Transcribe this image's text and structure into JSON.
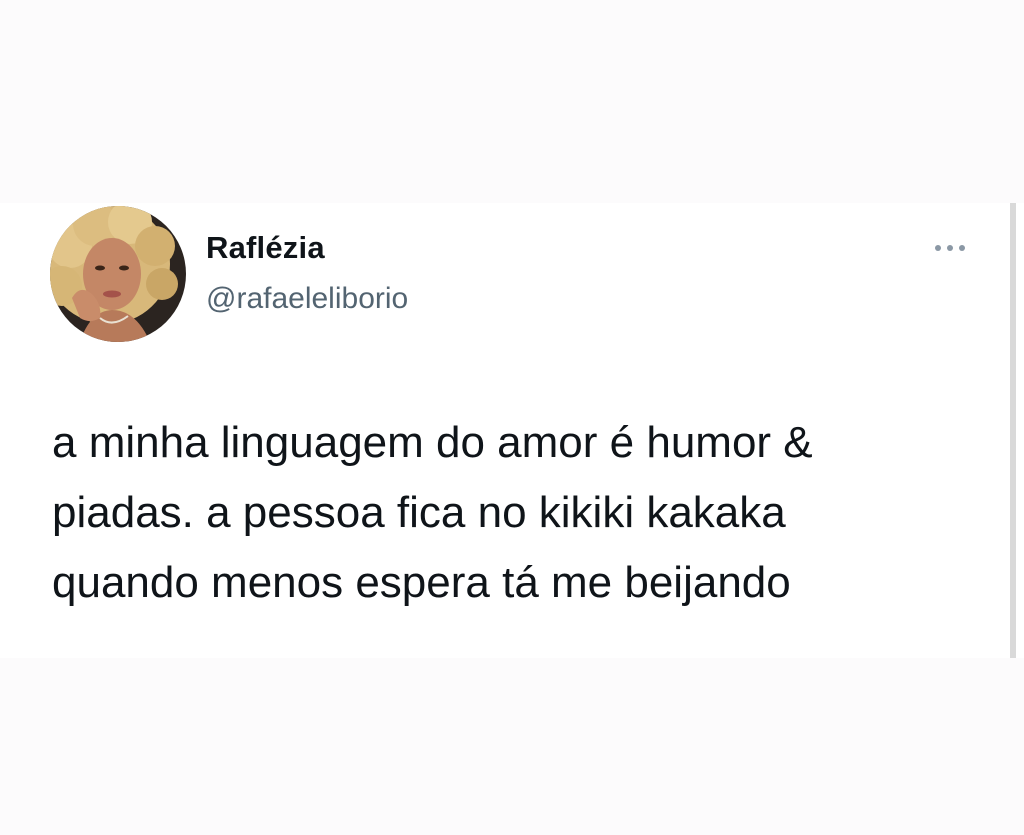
{
  "tweet": {
    "author": {
      "display_name": "Raflézia",
      "handle": "@rafaeleliborio",
      "avatar_icon": "profile-photo"
    },
    "more_icon": "more-horizontal-icon",
    "text_lines": [
      "a minha linguagem do amor é humor &",
      "piadas. a pessoa fica no kikiki kakaka",
      "quando menos espera tá me beijando"
    ]
  },
  "colors": {
    "text_primary": "#0f1419",
    "text_secondary": "#536471",
    "icon": "#8b98a5",
    "card_background": "#ffffff",
    "page_background": "#fcfbfc"
  }
}
